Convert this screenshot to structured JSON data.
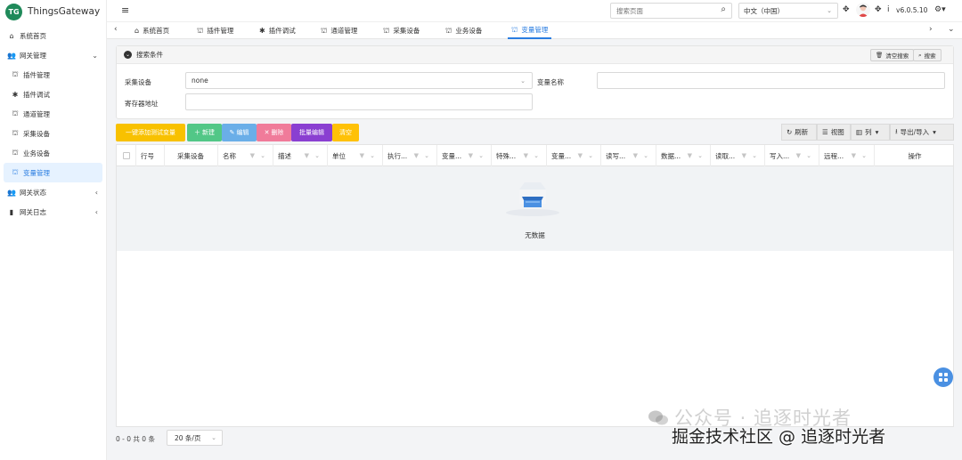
{
  "app": {
    "logo_text": "TG",
    "name": "ThingsGateway"
  },
  "sidebar": {
    "items": [
      {
        "label": "系统首页",
        "icon": "home-icon"
      },
      {
        "label": "网关管理",
        "icon": "users-icon",
        "expanded": true
      },
      {
        "label": "插件管理",
        "icon": "sitemap-icon"
      },
      {
        "label": "插件调试",
        "icon": "bug-icon"
      },
      {
        "label": "通道管理",
        "icon": "sitemap-icon"
      },
      {
        "label": "采集设备",
        "icon": "sitemap-icon"
      },
      {
        "label": "业务设备",
        "icon": "sitemap-icon"
      },
      {
        "label": "变量管理",
        "icon": "sitemap-icon",
        "active": true
      },
      {
        "label": "网关状态",
        "icon": "users-icon"
      },
      {
        "label": "网关日志",
        "icon": "book-icon"
      }
    ]
  },
  "topbar": {
    "search_placeholder": "搜索页面",
    "language": "中文（中国）",
    "version": "v6.0.5.10"
  },
  "tabs": [
    {
      "label": "系统首页",
      "icon": "home-icon"
    },
    {
      "label": "插件管理",
      "icon": "sitemap-icon"
    },
    {
      "label": "插件调试",
      "icon": "bug-icon"
    },
    {
      "label": "通道管理",
      "icon": "sitemap-icon"
    },
    {
      "label": "采集设备",
      "icon": "sitemap-icon"
    },
    {
      "label": "业务设备",
      "icon": "sitemap-icon"
    },
    {
      "label": "变量管理",
      "icon": "sitemap-icon",
      "active": true
    }
  ],
  "search_panel": {
    "title": "搜索条件",
    "clear_label": "清空搜索",
    "search_label": "搜索",
    "device_label": "采集设备",
    "device_value": "none",
    "varname_label": "变量名称",
    "varname_value": "",
    "register_label": "寄存器地址",
    "register_value": ""
  },
  "actions": {
    "add_test": "一键添加测试变量",
    "new": "新建",
    "edit": "编辑",
    "delete": "删除",
    "batch_edit": "批量编辑",
    "clear": "清空",
    "refresh": "刷新",
    "view": "视图",
    "columns": "列",
    "export": "导出/导入"
  },
  "table": {
    "columns": [
      "行号",
      "采集设备",
      "名称",
      "描述",
      "单位",
      "执行...",
      "变量...",
      "特殊...",
      "变量...",
      "读写...",
      "数据...",
      "读取...",
      "写入...",
      "远程...",
      "操作"
    ],
    "empty_text": "无数据"
  },
  "pager": {
    "summary": "0 - 0 共 0 条",
    "page_size": "20 条/页"
  },
  "watermark": {
    "line1": "公众号 · 追逐时光者",
    "line2": "掘金技术社区 @ 追逐时光者"
  },
  "colors": {
    "primary": "#2a7de1",
    "add_test": "#f8c100",
    "new": "#52c787",
    "edit": "#6aaee8",
    "delete": "#f07b9a",
    "batch_edit": "#8a3fd1",
    "clear": "#ffc107",
    "logo": "#1f8a5a"
  }
}
